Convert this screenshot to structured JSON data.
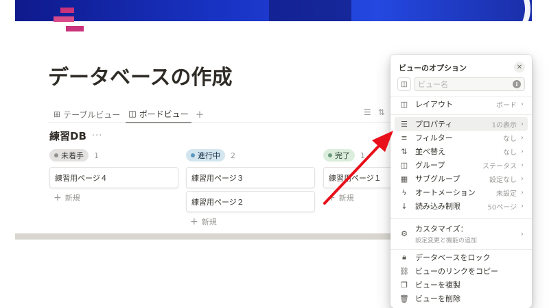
{
  "page": {
    "title": "データベースの作成"
  },
  "tabs": [
    {
      "label": "テーブルビュー",
      "icon": "table-icon",
      "active": false
    },
    {
      "label": "ボードビュー",
      "icon": "board-icon",
      "active": true
    }
  ],
  "database": {
    "title": "練習DB",
    "more": "···"
  },
  "board": {
    "columns": [
      {
        "status": "未着手",
        "count": "1",
        "badge_bg": "#e3e2e0",
        "dot": "#91918e",
        "badge_fg": "#32302c",
        "cards": [
          "練習用ページ４"
        ],
        "add_label": "新規"
      },
      {
        "status": "進行中",
        "count": "2",
        "badge_bg": "#d3e5ef",
        "dot": "#5b97bd",
        "badge_fg": "#183347",
        "cards": [
          "練習用ページ３",
          "練習用ページ２"
        ],
        "add_label": "新規"
      },
      {
        "status": "完了",
        "count": "1",
        "badge_bg": "#dbeddb",
        "dot": "#6c9b7d",
        "badge_fg": "#1c3829",
        "cards": [
          "練習用ページ１"
        ],
        "add_label": "新規"
      }
    ]
  },
  "options_panel": {
    "title": "ビューのオプション",
    "name_placeholder": "ビュー名",
    "rows": [
      {
        "label": "レイアウト",
        "value": "ボード",
        "icon": "layout-icon"
      },
      {
        "label": "プロパティ",
        "value": "1の表示",
        "icon": "properties-icon"
      },
      {
        "label": "フィルター",
        "value": "なし",
        "icon": "filter-icon"
      },
      {
        "label": "並べ替え",
        "value": "なし",
        "icon": "sort-icon"
      },
      {
        "label": "グループ",
        "value": "ステータス",
        "icon": "group-icon"
      },
      {
        "label": "サブグループ",
        "value": "設定なし",
        "icon": "subgroup-icon"
      },
      {
        "label": "オートメーション",
        "value": "未設定",
        "icon": "automation-icon"
      },
      {
        "label": "読み込み制限",
        "value": "50ページ",
        "icon": "load-limit-icon"
      }
    ],
    "customize": {
      "label": "カスタマイズ：",
      "sub": "設定変更と機能の追加"
    },
    "actions": [
      {
        "label": "データベースをロック",
        "icon": "lock-icon"
      },
      {
        "label": "ビューのリンクをコピー",
        "icon": "link-icon"
      },
      {
        "label": "ビューを複製",
        "icon": "duplicate-icon"
      },
      {
        "label": "ビューを削除",
        "icon": "trash-icon"
      }
    ]
  },
  "colors": {
    "arrow": "#e8101a",
    "cover": "#1833c4",
    "icon_accent": "#c9337b"
  }
}
